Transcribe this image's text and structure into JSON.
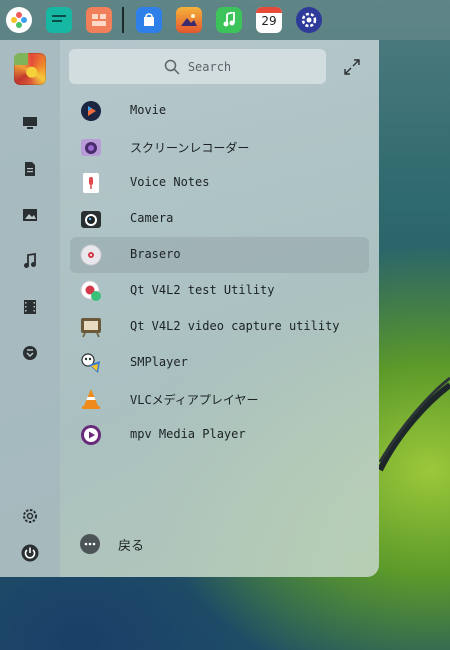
{
  "taskbar": {
    "calendar_day": "29",
    "apps": [
      {
        "name": "launcher-icon"
      },
      {
        "name": "file-manager-icon"
      },
      {
        "name": "multitask-view-icon"
      },
      {
        "name": "app-store-icon"
      },
      {
        "name": "photos-icon"
      },
      {
        "name": "music-icon"
      },
      {
        "name": "calendar-icon"
      },
      {
        "name": "settings-icon"
      }
    ]
  },
  "search": {
    "placeholder": "Search"
  },
  "sidebar": {
    "categories": [
      "monitor-icon",
      "document-icon",
      "image-icon",
      "music-note-icon",
      "film-icon",
      "download-icon"
    ],
    "bottom": [
      "settings-icon",
      "power-icon"
    ]
  },
  "apps": [
    {
      "label": "Movie",
      "icon": "movie-player-icon"
    },
    {
      "label": "スクリーンレコーダー",
      "icon": "screen-recorder-icon"
    },
    {
      "label": "Voice Notes",
      "icon": "voice-notes-icon"
    },
    {
      "label": "Camera",
      "icon": "camera-icon"
    },
    {
      "label": "Brasero",
      "icon": "brasero-disc-icon",
      "selected": true
    },
    {
      "label": "Qt V4L2 test Utility",
      "icon": "qt-v4l2-test-icon"
    },
    {
      "label": "Qt V4L2 video capture utility",
      "icon": "qt-v4l2-capture-icon"
    },
    {
      "label": "SMPlayer",
      "icon": "smplayer-icon"
    },
    {
      "label": "VLCメディアプレイヤー",
      "icon": "vlc-icon"
    },
    {
      "label": "mpv Media Player",
      "icon": "mpv-icon"
    }
  ],
  "footer": {
    "back_label": "戻る"
  }
}
